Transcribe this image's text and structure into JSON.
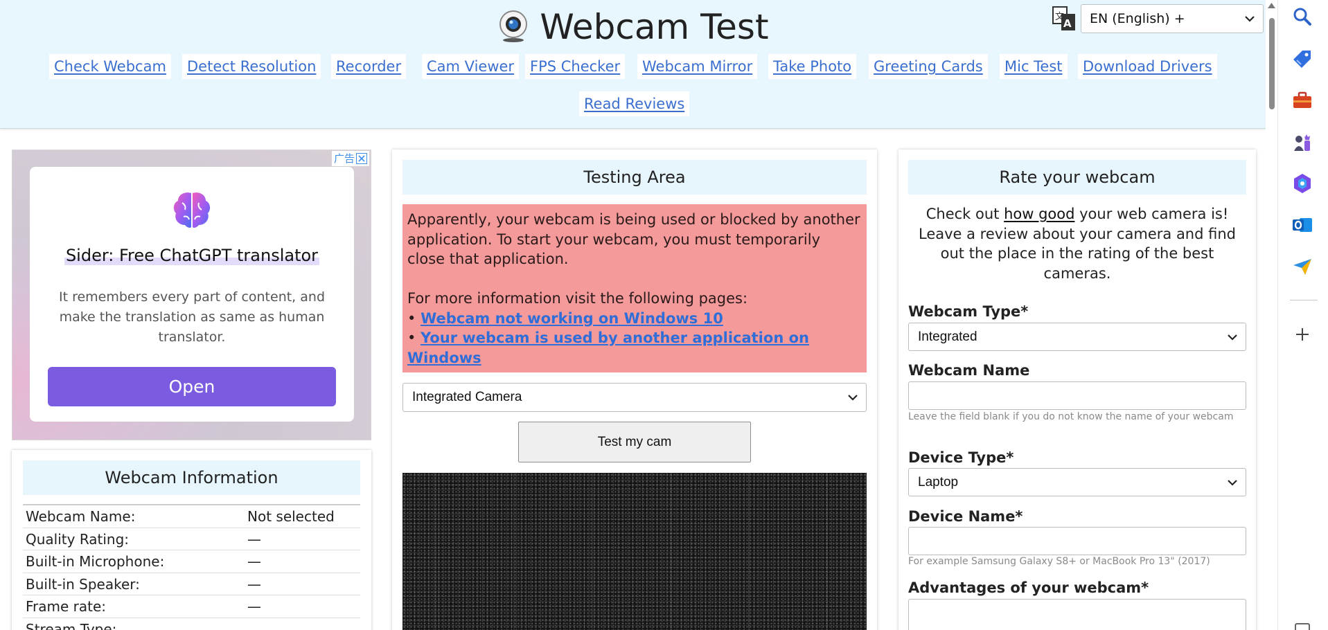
{
  "header": {
    "title": "Webcam Test",
    "language": "EN (English) +",
    "nav": [
      {
        "label": "Check Webcam"
      },
      {
        "label": "Detect Resolution"
      },
      {
        "label": "Recorder"
      },
      {
        "label": "Cam Viewer"
      },
      {
        "label": "FPS Checker"
      },
      {
        "label": "Webcam Mirror"
      },
      {
        "label": "Take Photo"
      },
      {
        "label": "Greeting Cards"
      },
      {
        "label": "Mic Test"
      },
      {
        "label": "Download Drivers"
      },
      {
        "label": "Read Reviews"
      }
    ]
  },
  "ad": {
    "corner_label": "广告",
    "title": "Sider: Free ChatGPT translator",
    "description": "It remembers every part of content, and make the translation as same as human translator.",
    "button": "Open",
    "accent_color": "#7b5ce0"
  },
  "webcam_info": {
    "heading": "Webcam Information",
    "rows": [
      {
        "key": "Webcam Name:",
        "value": "Not selected"
      },
      {
        "key": "Quality Rating:",
        "value": "—"
      },
      {
        "key": "Built-in Microphone:",
        "value": "—"
      },
      {
        "key": "Built-in Speaker:",
        "value": "—"
      },
      {
        "key": "Frame rate:",
        "value": "—"
      },
      {
        "key": "Stream Type:",
        "value": ""
      }
    ]
  },
  "testing": {
    "heading": "Testing Area",
    "alert_text": "Apparently, your webcam is being used or blocked by another application. To start your webcam, you must temporarily close that application.",
    "more_info": "For more information visit the following pages:",
    "links": [
      "Webcam not working on Windows 10",
      "Your webcam is used by another application on Windows"
    ],
    "camera_selected": "Integrated Camera",
    "test_button": "Test my cam",
    "alert_color": "#f49a9a"
  },
  "rate": {
    "heading": "Rate your webcam",
    "intro_before": "Check out ",
    "intro_link": "how good",
    "intro_after": " your web camera is! Leave a review about your camera and find out the place in the rating of the best cameras.",
    "webcam_type_label": "Webcam Type*",
    "webcam_type_value": "Integrated",
    "webcam_name_label": "Webcam Name",
    "webcam_name_value": "",
    "webcam_name_hint": "Leave the field blank if you do not know the name of your webcam",
    "device_type_label": "Device Type*",
    "device_type_value": "Laptop",
    "device_name_label": "Device Name*",
    "device_name_value": "",
    "device_name_hint": "For example Samsung Galaxy S8+ or MacBook Pro 13\" (2017)",
    "advantages_label": "Advantages of your webcam*"
  },
  "side_toolbar": {
    "icons": [
      "search-icon",
      "tag-icon",
      "briefcase-icon",
      "chess-icon",
      "hexagon-app-icon",
      "outlook-icon",
      "send-icon",
      "plus-icon"
    ]
  }
}
